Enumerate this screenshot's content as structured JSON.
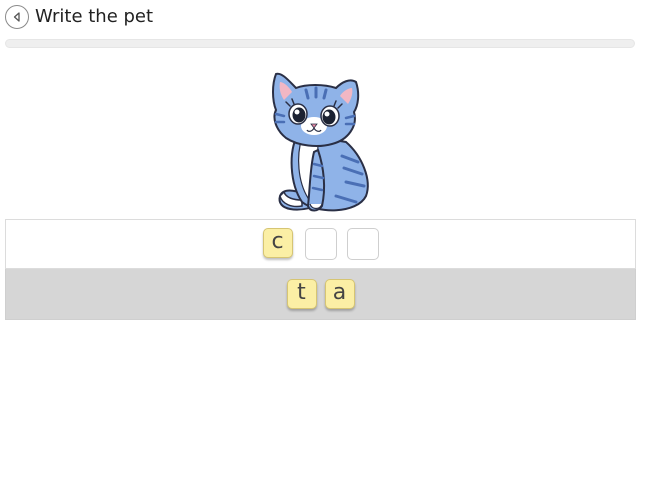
{
  "header": {
    "title": "Write the pet",
    "back_icon": "chevron-left-icon"
  },
  "progress": {
    "value": 0
  },
  "image": {
    "subject": "cat",
    "colors": {
      "body": "#8fb3e8",
      "stripes": "#4a6fb5",
      "belly": "#ffffff",
      "outline": "#2a2f45",
      "ear_inner": "#f2b7c4"
    }
  },
  "answer": {
    "slots": [
      {
        "letter": "c"
      },
      {
        "letter": ""
      },
      {
        "letter": ""
      }
    ]
  },
  "letter_bank": {
    "tiles": [
      "t",
      "a"
    ]
  },
  "colors": {
    "tile_bg": "#fbefa5",
    "bank_bg": "#d6d6d6"
  }
}
